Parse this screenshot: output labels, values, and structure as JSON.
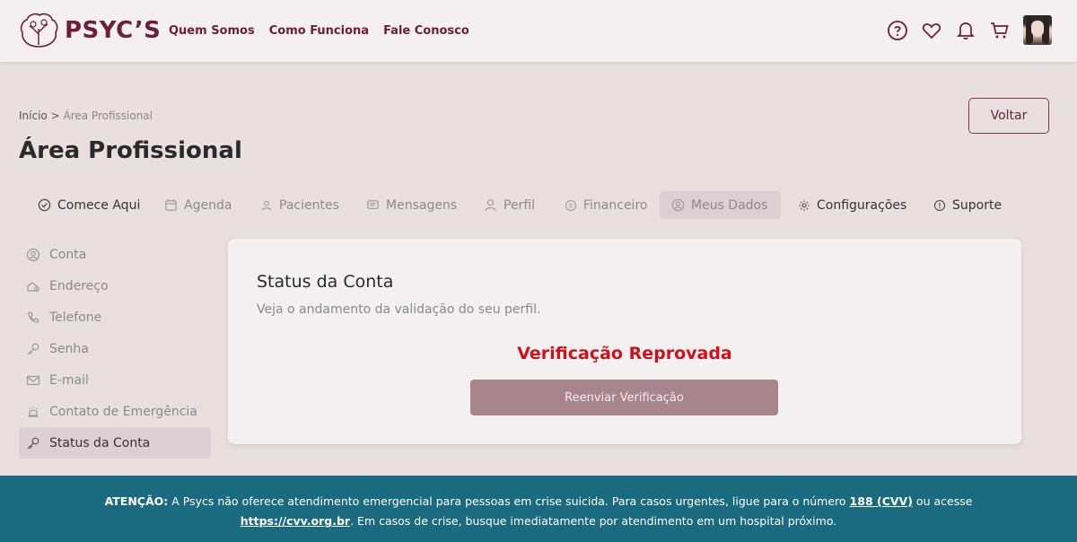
{
  "header": {
    "brand": "PSYC’S",
    "nav": [
      "Quem Somos",
      "Como Funciona",
      "Fale Conosco"
    ],
    "icons": [
      "help-icon",
      "heart-icon",
      "bell-icon",
      "cart-icon"
    ]
  },
  "breadcrumb": {
    "home": "Início",
    "separator": ">",
    "current": "Área Profissional"
  },
  "page": {
    "title": "Área Profissional",
    "back_label": "Voltar"
  },
  "tabs": [
    {
      "label": "Comece Aqui",
      "icon": "check-circle-icon"
    },
    {
      "label": "Agenda",
      "icon": "calendar-icon"
    },
    {
      "label": "Pacientes",
      "icon": "user-icon"
    },
    {
      "label": "Mensagens",
      "icon": "message-icon"
    },
    {
      "label": "Perfil",
      "icon": "person-icon"
    },
    {
      "label": "Financeiro",
      "icon": "dollar-icon"
    },
    {
      "label": "Meus Dados",
      "icon": "user-circle-icon"
    },
    {
      "label": "Configurações",
      "icon": "gear-icon"
    },
    {
      "label": "Suporte",
      "icon": "info-icon"
    }
  ],
  "sidemenu": [
    {
      "label": "Conta",
      "icon": "user-circle-icon"
    },
    {
      "label": "Endereço",
      "icon": "home-icon"
    },
    {
      "label": "Telefone",
      "icon": "phone-icon"
    },
    {
      "label": "Senha",
      "icon": "key-icon"
    },
    {
      "label": "E-mail",
      "icon": "mail-icon"
    },
    {
      "label": "Contato de Emergência",
      "icon": "alarm-icon"
    },
    {
      "label": "Status da Conta",
      "icon": "key-icon"
    }
  ],
  "card": {
    "title": "Status da Conta",
    "subtitle": "Veja o andamento da validação do seu perfil.",
    "status": "Verificação Reprovada",
    "button": "Reenviar Verificação"
  },
  "footer": {
    "attention": "ATENÇÃO:",
    "text1": " A Psycs não oferece atendimento emergencial para pessoas em crise suicida. Para casos urgentes, ligue para o número ",
    "phone": "188 (CVV)",
    "text2": " ou acesse",
    "link": "https://cvv.org.br",
    "text3": ". Em casos de crise, busque imediatamente por atendimento em um hospital próximo."
  },
  "colors": {
    "brand": "#6b1f3b",
    "status_error": "#d0101a",
    "footer_bg": "#1b6b80",
    "button_bg": "#a8848e"
  }
}
